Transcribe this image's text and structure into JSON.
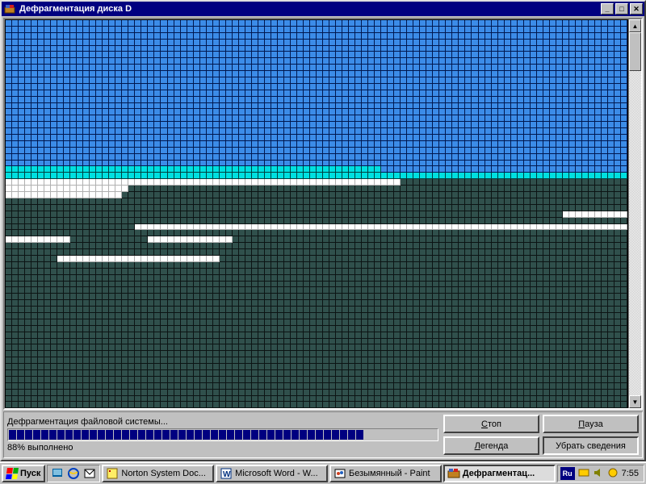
{
  "window": {
    "title": "Дефрагментация диска D"
  },
  "status": {
    "label": "Дефрагментация файловой системы...",
    "percent_text": "88% выполнено",
    "percent": 88,
    "segments_total": 50,
    "segments_filled": 44
  },
  "buttons": {
    "stop": "Стоп",
    "pause": "Пауза",
    "legend": "Легенда",
    "details": "Убрать сведения"
  },
  "grid": {
    "cols": 96,
    "rows": 62,
    "colors": {
      "b0": "#3c8ce8",
      "b1": "#00e0e0",
      "b2": "#ffffff",
      "b3": "#30504c"
    },
    "segments": [
      {
        "from": 0,
        "to": 2207,
        "c": "b0"
      },
      {
        "from": 2208,
        "to": 2265,
        "c": "b1"
      },
      {
        "from": 2266,
        "to": 2303,
        "c": "b0"
      },
      {
        "from": 2304,
        "to": 2399,
        "c": "b1"
      },
      {
        "from": 2400,
        "to": 2460,
        "c": "b2"
      },
      {
        "from": 2461,
        "to": 2495,
        "c": "b3"
      },
      {
        "from": 2496,
        "to": 2514,
        "c": "b2"
      },
      {
        "from": 2515,
        "to": 2591,
        "c": "b3"
      },
      {
        "from": 2592,
        "to": 2609,
        "c": "b2"
      },
      {
        "from": 2610,
        "to": 2687,
        "c": "b3"
      },
      {
        "from": 2688,
        "to": 2783,
        "c": "b3"
      },
      {
        "from": 2784,
        "to": 2879,
        "c": "b3"
      },
      {
        "from": 2880,
        "to": 2965,
        "c": "b3"
      },
      {
        "from": 2966,
        "to": 2975,
        "c": "b2"
      },
      {
        "from": 2976,
        "to": 3071,
        "c": "b3"
      },
      {
        "from": 3072,
        "to": 3091,
        "c": "b3"
      },
      {
        "from": 3092,
        "to": 3167,
        "c": "b2"
      },
      {
        "from": 3168,
        "to": 3263,
        "c": "b3"
      },
      {
        "from": 3264,
        "to": 3273,
        "c": "b2"
      },
      {
        "from": 3274,
        "to": 3285,
        "c": "b3"
      },
      {
        "from": 3286,
        "to": 3298,
        "c": "b2"
      },
      {
        "from": 3299,
        "to": 3359,
        "c": "b3"
      },
      {
        "from": 3360,
        "to": 3455,
        "c": "b3"
      },
      {
        "from": 3456,
        "to": 3551,
        "c": "b3"
      },
      {
        "from": 3552,
        "to": 3559,
        "c": "b3"
      },
      {
        "from": 3560,
        "to": 3584,
        "c": "b2"
      },
      {
        "from": 3585,
        "to": 3647,
        "c": "b3"
      },
      {
        "from": 3648,
        "to": 5951,
        "c": "b3"
      }
    ]
  },
  "taskbar": {
    "start": "Пуск",
    "tasks": [
      {
        "label": "Norton System Doc...",
        "active": false
      },
      {
        "label": "Microsoft Word - W...",
        "active": false
      },
      {
        "label": "Безымянный - Paint",
        "active": false
      },
      {
        "label": "Дефрагментац...",
        "active": true
      }
    ],
    "lang": "Ru",
    "clock": "7:55"
  }
}
